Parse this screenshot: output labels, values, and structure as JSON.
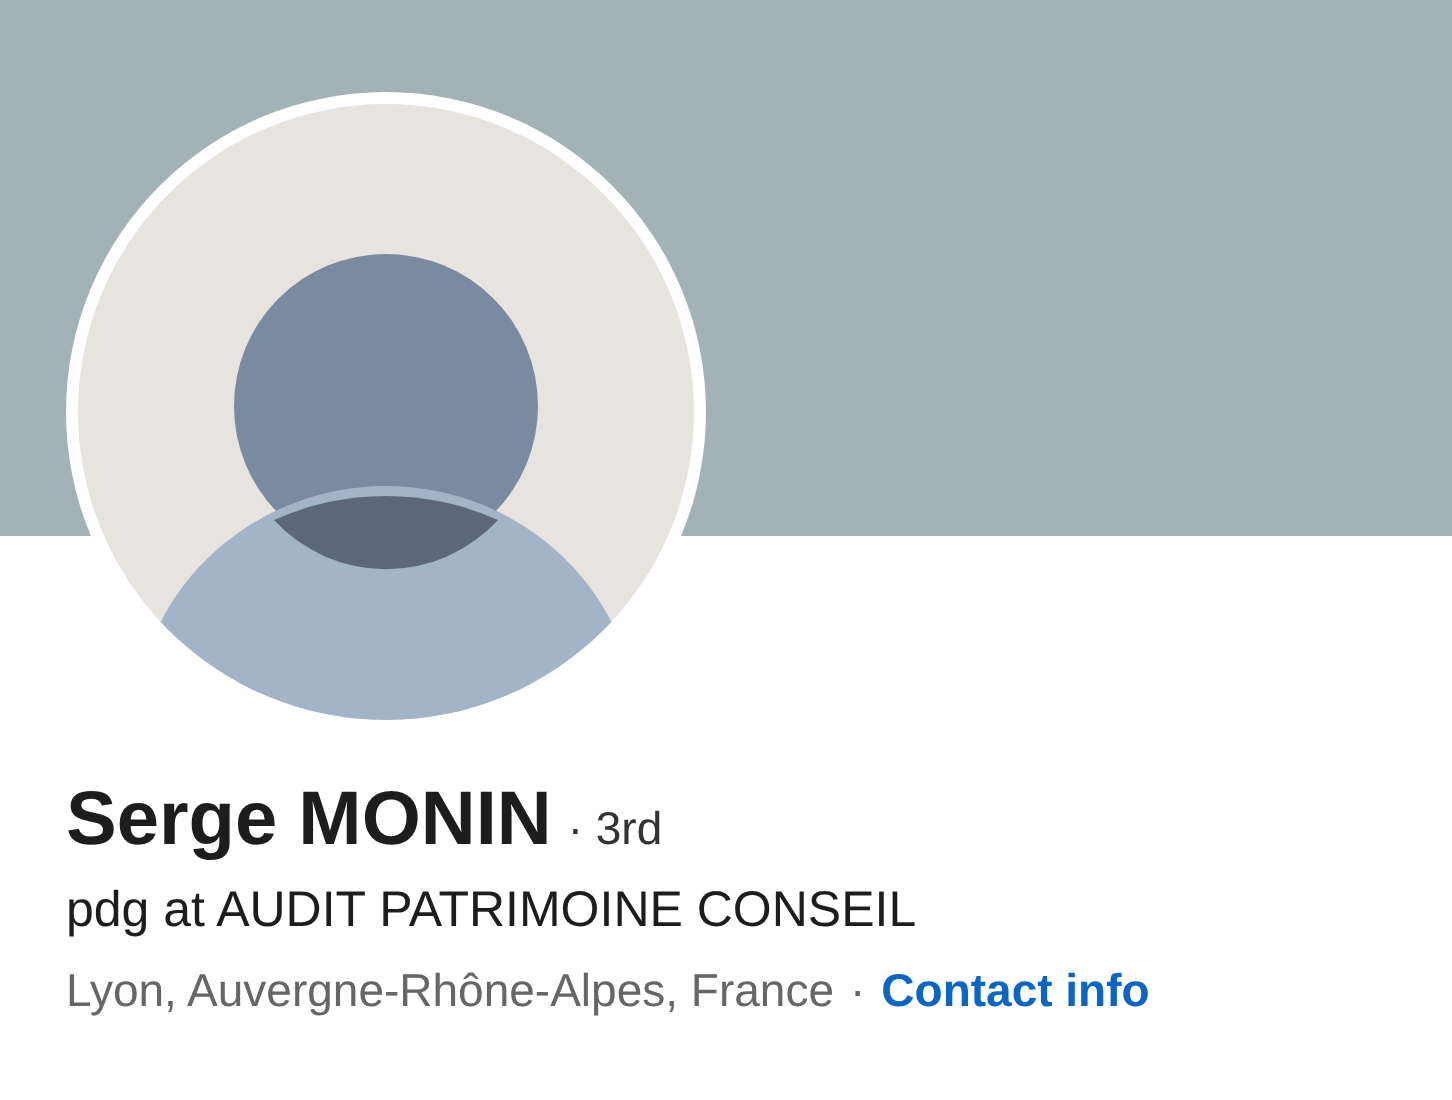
{
  "profile": {
    "name": "Serge MONIN",
    "degree": "· 3rd",
    "headline": "pdg at AUDIT PATRIMOINE CONSEIL",
    "location": "Lyon, Auvergne-Rhône-Alpes, France",
    "separator": "·",
    "contact_link": "Contact info"
  }
}
